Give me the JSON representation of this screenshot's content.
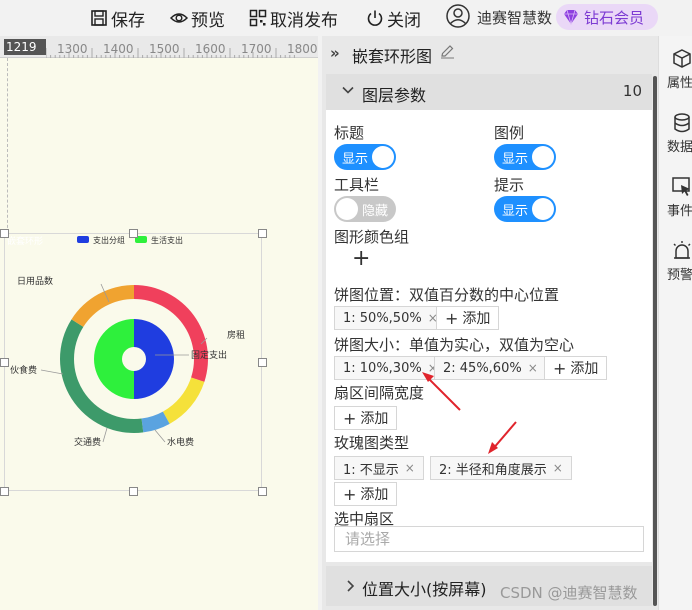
{
  "toolbar": {
    "save_label": "保存",
    "preview_label": "预览",
    "unpublish_label": "取消发布",
    "close_label": "关闭",
    "user_name": "迪赛智慧数",
    "vip_label": "钻石会员"
  },
  "ruler": {
    "start": "1219",
    "marks": [
      "1300",
      "1400",
      "1500",
      "1600",
      "1700",
      "1800"
    ]
  },
  "chart_data": {
    "type": "nested-donut",
    "title": "嵌套环形",
    "legend": [
      "支出分组",
      "生活支出"
    ],
    "inner_series": {
      "name": "支出分组",
      "slices": [
        {
          "label": "固定支出",
          "value": 50,
          "color": "#1f3de0"
        },
        {
          "label": "生活支出",
          "value": 50,
          "color": "#2ef03c"
        }
      ]
    },
    "outer_series": {
      "name": "生活支出",
      "slices": [
        {
          "label": "房租",
          "value": 30,
          "color": "#f0405c"
        },
        {
          "label": "水电费",
          "value": 12,
          "color": "#f5e13a"
        },
        {
          "label": "交通费",
          "value": 6,
          "color": "#5aa3e0"
        },
        {
          "label": "伙食费",
          "value": 36,
          "color": "#3d9a6a"
        },
        {
          "label": "日用品数",
          "value": 16,
          "color": "#f0a330"
        }
      ]
    },
    "labels": {
      "daily": "日用品数",
      "rent": "房租",
      "food": "伙食费",
      "fixed": "固定支出",
      "transport": "交通费",
      "utilities": "水电费"
    }
  },
  "panel": {
    "title": "嵌套环形图",
    "section_title": "图层参数",
    "section_count": "10",
    "title_label": "标题",
    "title_toggle": "显示",
    "legend_label": "图例",
    "legend_toggle": "显示",
    "toolbar_label": "工具栏",
    "toolbar_toggle": "隐藏",
    "tooltip_label": "提示",
    "tooltip_toggle": "显示",
    "color_group_label": "图形颜色组",
    "plus": "+",
    "pie_position_label": "饼图位置：双值百分数的中心位置",
    "pie_position_tag": "1: 50%,50%",
    "pie_size_label": "饼图大小：单值为实心，双值为空心",
    "pie_size_tag1": "1: 10%,30%",
    "pie_size_tag2": "2: 45%,60%",
    "sector_gap_label": "扇区间隔宽度",
    "rose_label": "玫瑰图类型",
    "rose_tag1": "1: 不显示",
    "rose_tag2": "2: 半径和角度展示",
    "selected_label": "选中扇区",
    "selected_placeholder": "请选择",
    "add_label": "添加",
    "remove": "×",
    "section2_title": "位置大小(按屏幕)"
  },
  "rightbar": {
    "attr": "属性",
    "data": "数据",
    "event": "事件",
    "alert": "预警"
  },
  "watermark": "CSDN @迪赛智慧数",
  "colors": {
    "toggle_on": "#1e90ff",
    "vip": "#7d3bd3",
    "arrow": "#e0242c"
  }
}
